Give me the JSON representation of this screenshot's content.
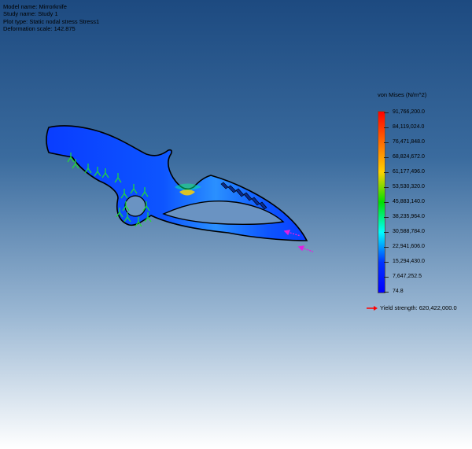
{
  "info": {
    "model": "Model name: Mirrorknife",
    "study": "Study name: Study 1",
    "plot_type": "Plot type: Static nodal stress Stress1",
    "deformation": "Deformation scale: 142.875"
  },
  "legend": {
    "title": "von Mises (N/m^2)",
    "ticks": [
      "91,766,200.0",
      "84,119,024.0",
      "76,471,848.0",
      "68,824,672.0",
      "61,177,496.0",
      "53,530,320.0",
      "45,883,140.0",
      "38,235,964.0",
      "30,588,784.0",
      "22,941,606.0",
      "15,294,430.0",
      "7,647,252.5",
      "74.8"
    ],
    "colors": [
      "#ff0000",
      "#ff6a00",
      "#ffd200",
      "#00e000",
      "#00ffff",
      "#0033ff",
      "#0000ff"
    ],
    "yield_strength": "Yield strength: 620,422,000.0",
    "yield_arrow_color": "#ff0000"
  },
  "model": {
    "mesh_color": "#0a4dff",
    "fixture_color": "#22dd33",
    "load_color": "#e020e0",
    "outline_color": "#000000"
  }
}
